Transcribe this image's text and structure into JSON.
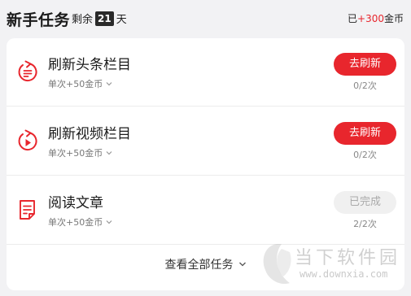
{
  "header": {
    "title": "新手任务",
    "remain_prefix": "剩余",
    "remain_days": "21",
    "remain_suffix": "天",
    "reward_prefix": "已",
    "reward_amount": "+300",
    "reward_suffix": "金币"
  },
  "tasks": [
    {
      "name": "刷新头条栏目",
      "reward": "单次+50金币",
      "button": "去刷新",
      "progress": "0/2次",
      "icon": "refresh-list-icon",
      "status": "todo"
    },
    {
      "name": "刷新视频栏目",
      "reward": "单次+50金币",
      "button": "去刷新",
      "progress": "0/2次",
      "icon": "refresh-video-icon",
      "status": "todo"
    },
    {
      "name": "阅读文章",
      "reward": "单次+50金币",
      "button": "已完成",
      "progress": "2/2次",
      "icon": "article-icon",
      "status": "done"
    }
  ],
  "footer": {
    "more_label": "查看全部任务"
  },
  "watermark": {
    "text": "当下软件园",
    "url": "www.downxia.com"
  },
  "colors": {
    "accent": "#e8262d",
    "background": "#f2f2f4",
    "done_button": "#f0f0f0"
  }
}
